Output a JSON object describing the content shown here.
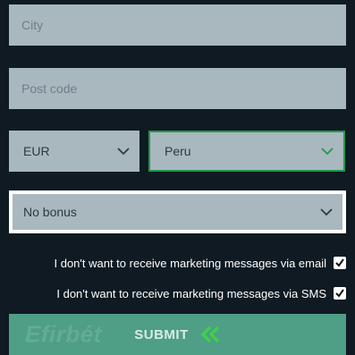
{
  "form": {
    "city": {
      "placeholder": "City"
    },
    "postcode": {
      "placeholder": "Post code"
    },
    "currency": {
      "value": "EUR"
    },
    "country": {
      "value": "Peru"
    },
    "bonus": {
      "value": "No bonus"
    },
    "checkboxes": [
      {
        "label": "I don't want to receive marketing messages via email",
        "checked": true
      },
      {
        "label": "I don't want to receive marketing messages via SMS",
        "checked": true
      }
    ],
    "submit_label": "SUBMIT",
    "brand_watermark": "Efirbét"
  },
  "colors": {
    "background": "#0f1a22",
    "field": "#a9b8bf",
    "active_border": "#1f9a4a",
    "submit": "#4f9e86",
    "arrows": "#3fd04a"
  },
  "icons": [
    "chevron-down-icon",
    "check-icon",
    "double-chevron-left-icon"
  ]
}
